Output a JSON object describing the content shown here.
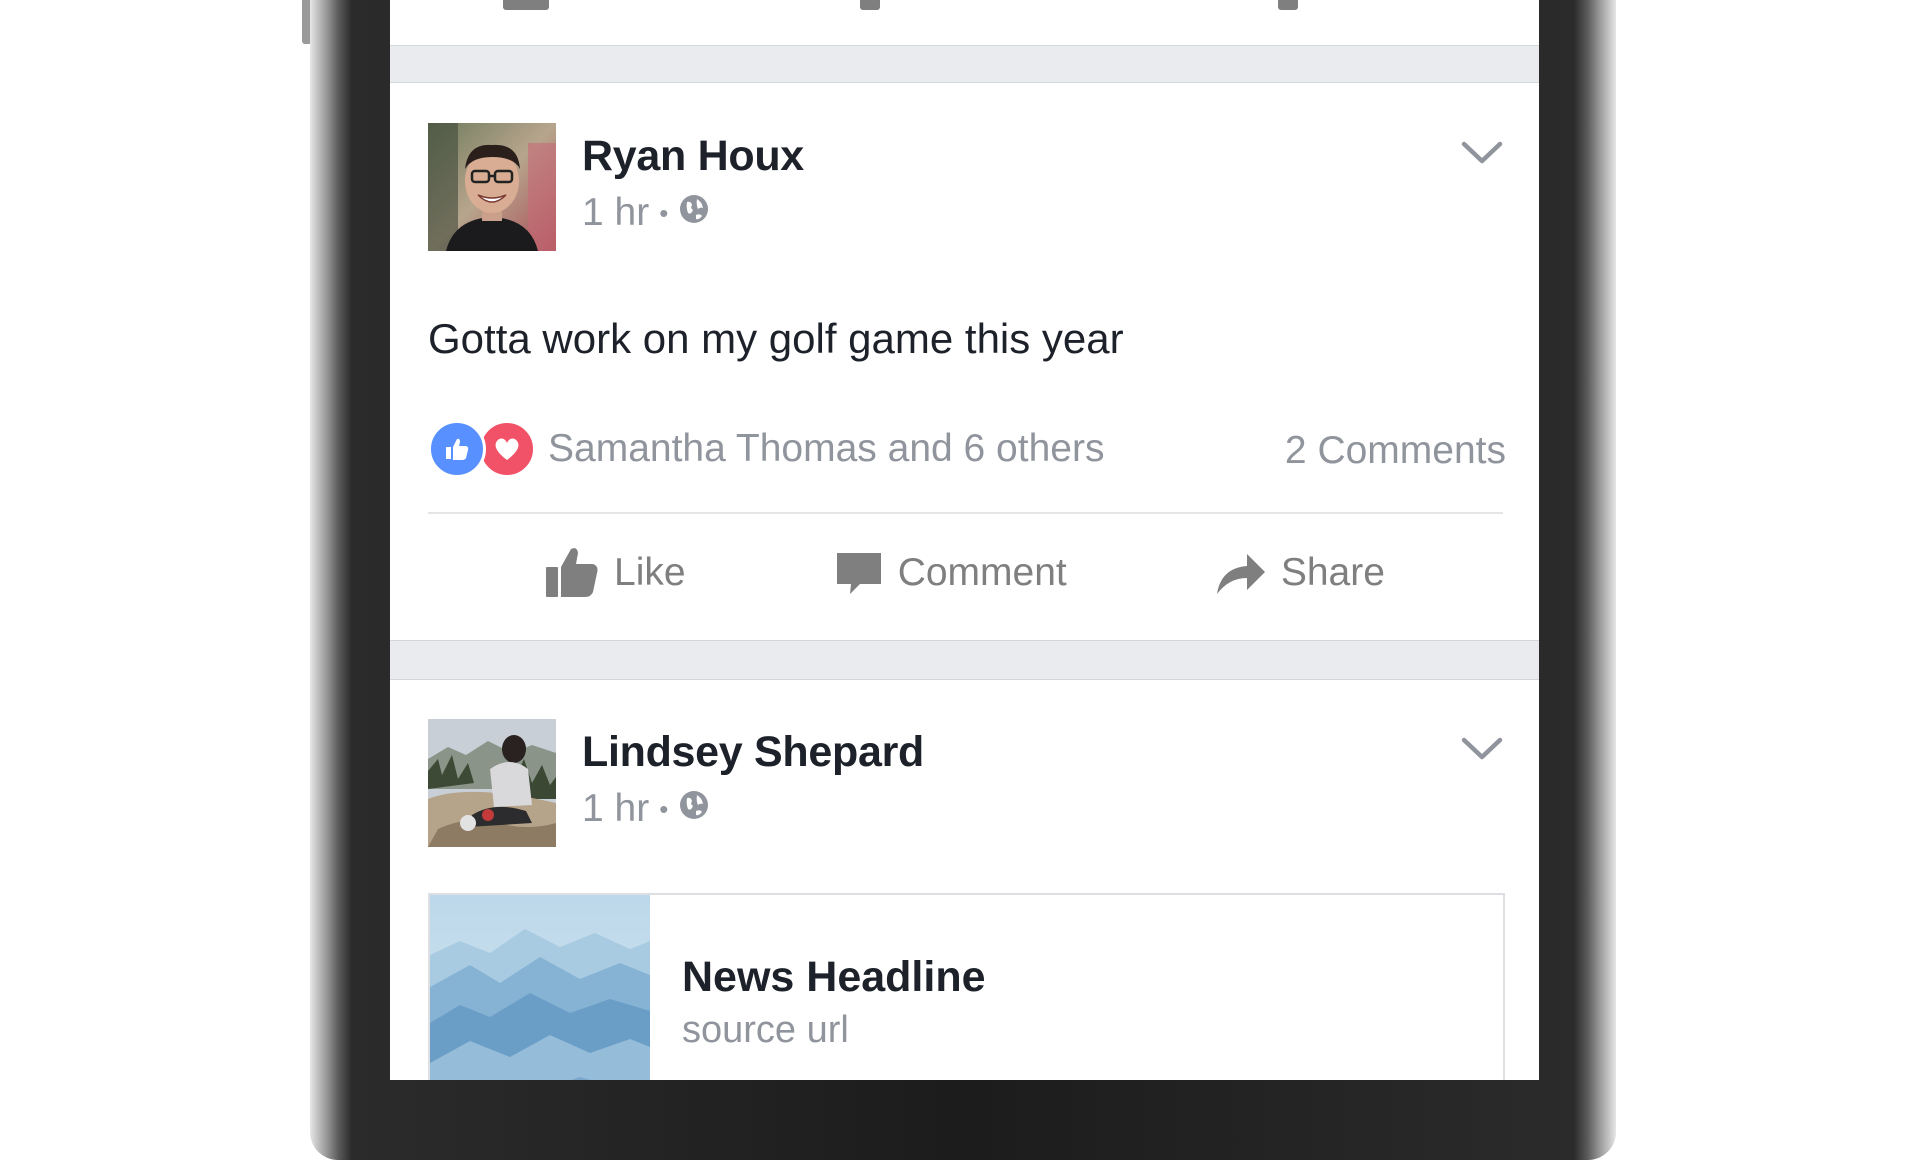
{
  "feed": {
    "posts": [
      {
        "author": "Ryan Houx",
        "time": "1 hr",
        "separator": "•",
        "privacy_icon": "globe-icon",
        "text": "Gotta work on my golf game this year",
        "reactions": [
          "like",
          "love"
        ],
        "reaction_names": "Samantha Thomas and 6 others",
        "comments": "2 Comments"
      },
      {
        "author": "Lindsey Shepard",
        "time": "1 hr",
        "separator": "•",
        "privacy_icon": "globe-icon",
        "link": {
          "title": "News Headline",
          "source": "source url"
        }
      }
    ],
    "actions": {
      "like": "Like",
      "comment": "Comment",
      "share": "Share"
    }
  },
  "colors": {
    "feed_background": "#e9ebee",
    "like_blue": "#5890ff",
    "love_red": "#f25268",
    "secondary_text": "#90949c",
    "primary_text": "#1d2129",
    "action_gray": "#7f7f7f"
  }
}
